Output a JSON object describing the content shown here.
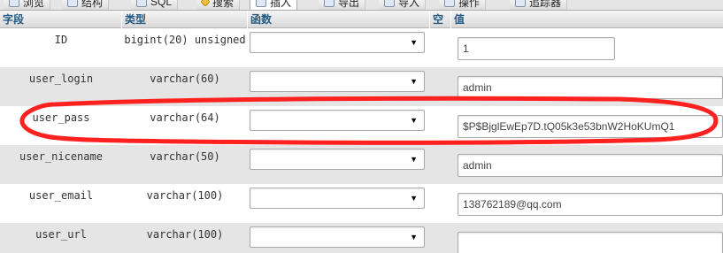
{
  "tabs": [
    {
      "label": "浏览"
    },
    {
      "label": "结构"
    },
    {
      "label": "SQL"
    },
    {
      "label": "搜索"
    },
    {
      "label": "插入"
    },
    {
      "label": "导出"
    },
    {
      "label": "导入"
    },
    {
      "label": "操作"
    },
    {
      "label": "追踪器"
    }
  ],
  "header": {
    "field": "字段",
    "type": "类型",
    "function": "函数",
    "null": "空",
    "value": "值"
  },
  "rows": [
    {
      "field": "ID",
      "type": "bigint(20) unsigned",
      "value": "1"
    },
    {
      "field": "user_login",
      "type": "varchar(60)",
      "value": "admin"
    },
    {
      "field": "user_pass",
      "type": "varchar(64)",
      "value": "$P$BjglEwEp7D.tQ05k3e53bnW2HoKUmQ1"
    },
    {
      "field": "user_nicename",
      "type": "varchar(50)",
      "value": "admin"
    },
    {
      "field": "user_email",
      "type": "varchar(100)",
      "value": "138762189@qq.com"
    },
    {
      "field": "user_url",
      "type": "varchar(100)",
      "value": ""
    }
  ],
  "annotation": {
    "color": "#ff2020",
    "shape": "freehand-ellipse"
  },
  "icons": {
    "select_arrow": "dropdown-arrow-icon"
  }
}
